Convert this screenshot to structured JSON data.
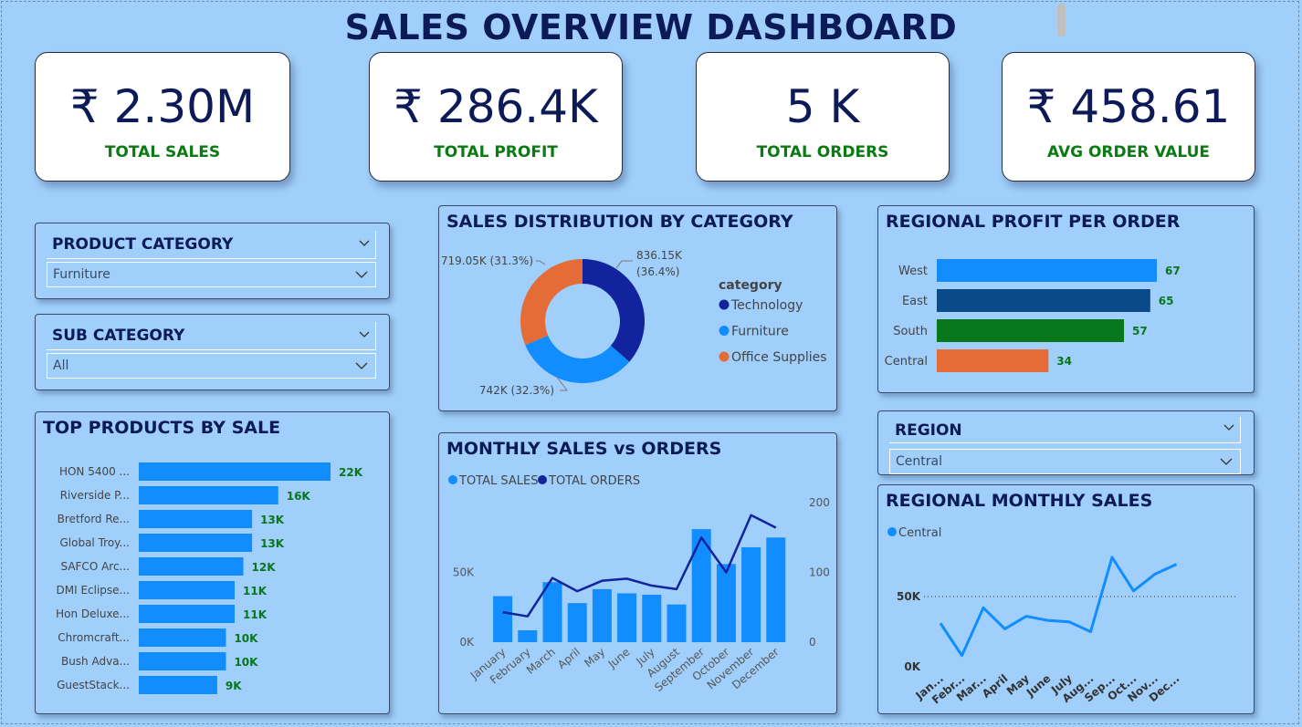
{
  "dashboard": {
    "title": "SALES OVERVIEW DASHBOARD"
  },
  "kpis": [
    {
      "value": "₹ 2.30M",
      "label": "TOTAL SALES"
    },
    {
      "value": "₹ 286.4K",
      "label": "TOTAL PROFIT"
    },
    {
      "value": "5 K",
      "label": "TOTAL ORDERS"
    },
    {
      "value": "₹ 458.61",
      "label": "AVG ORDER VALUE"
    }
  ],
  "slicers": {
    "product_category": {
      "title": "PRODUCT CATEGORY",
      "value": "Furniture"
    },
    "sub_category": {
      "title": "SUB CATEGORY",
      "value": "All"
    },
    "region": {
      "title": "REGION",
      "value": "Central"
    }
  },
  "colors": {
    "accent_blue": "#118dff",
    "navy": "#12239e",
    "dark_blue": "#0b4a8a",
    "green": "#07761c",
    "orange": "#e66c37",
    "kpi_label_green": "#0a7a12"
  },
  "chart_data": [
    {
      "type": "bar",
      "title": "TOP PRODUCTS BY SALE",
      "orientation": "horizontal",
      "categories": [
        "HON 5400 ...",
        "Riverside P...",
        "Bretford Re...",
        "Global Troy...",
        "SAFCO Arc...",
        "DMI Eclipse...",
        "Hon Deluxe...",
        "Chromcraft...",
        "Bush Adva...",
        "GuestStack..."
      ],
      "values": [
        22,
        16,
        13,
        13,
        12,
        11,
        11,
        10,
        10,
        9
      ],
      "labels": [
        "22K",
        "16K",
        "13K",
        "13K",
        "12K",
        "11K",
        "11K",
        "10K",
        "10K",
        "9K"
      ]
    },
    {
      "type": "pie",
      "title": "SALES DISTRIBUTION BY CATEGORY",
      "legend_title": "category",
      "legend_position": "right",
      "series": [
        {
          "name": "Technology",
          "value": 836.15,
          "label": "836.15K",
          "pct": "(36.4%)"
        },
        {
          "name": "Furniture",
          "value": 742,
          "label": "742K (32.3%)"
        },
        {
          "name": "Office Supplies",
          "value": 719.05,
          "label": "719.05K (31.3%)"
        }
      ]
    },
    {
      "type": "bar",
      "title": "REGIONAL PROFIT PER ORDER",
      "orientation": "horizontal",
      "categories": [
        "West",
        "East",
        "South",
        "Central"
      ],
      "values": [
        67,
        65,
        57,
        34
      ]
    },
    {
      "type": "bar",
      "title": "MONTHLY SALES vs ORDERS",
      "categories": [
        "January",
        "February",
        "March",
        "April",
        "May",
        "June",
        "July",
        "August",
        "September",
        "October",
        "November",
        "December"
      ],
      "legend_position": "top-left",
      "series": [
        {
          "name": "TOTAL SALES",
          "kind": "bar",
          "values": [
            33000,
            8500,
            43000,
            28000,
            38000,
            35000,
            34000,
            27000,
            81000,
            56000,
            68000,
            75000
          ]
        },
        {
          "name": "TOTAL ORDERS",
          "kind": "line",
          "values": [
            43,
            37,
            92,
            73,
            88,
            91,
            81,
            76,
            150,
            100,
            182,
            164
          ]
        }
      ],
      "y_left_ticks": [
        "0K",
        "50K"
      ],
      "y_right_ticks": [
        "0",
        "100",
        "200"
      ],
      "ylim_left": [
        0,
        100000
      ],
      "ylim_right": [
        0,
        200
      ]
    },
    {
      "type": "line",
      "title": "REGIONAL MONTHLY SALES",
      "legend_position": "top-left",
      "categories": [
        "Jan...",
        "Febr...",
        "Mar...",
        "April",
        "May",
        "June",
        "July",
        "Aug...",
        "Sep...",
        "Oct...",
        "Nov...",
        "Dec..."
      ],
      "series": [
        {
          "name": "Central",
          "values": [
            31000,
            8000,
            42000,
            27000,
            36000,
            33000,
            32000,
            25000,
            78000,
            54000,
            66000,
            73000
          ]
        }
      ],
      "y_ticks": [
        "0K",
        "50K"
      ],
      "ylim": [
        0,
        100000
      ]
    }
  ]
}
